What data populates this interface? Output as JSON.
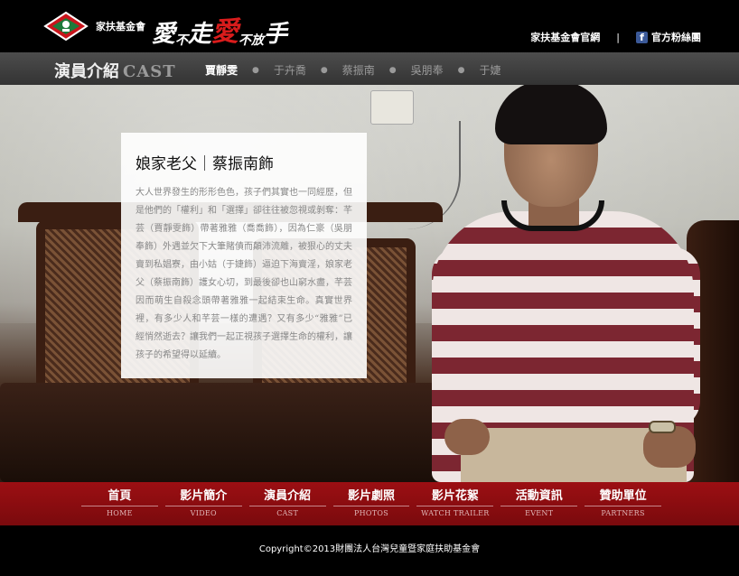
{
  "header": {
    "org_name": "家扶基金會",
    "slogan": {
      "part1": "愛",
      "part2": "不",
      "part3": "走",
      "part4": "愛",
      "part5": "不",
      "part6": "放",
      "part7": "手"
    },
    "links": {
      "official_site": "家扶基金會官網",
      "separator": "|",
      "fan_page": "官方粉絲團",
      "fb_glyph": "f"
    },
    "logo_icon": "fcf-logo-icon"
  },
  "cast_bar": {
    "title_cn": "演員介紹",
    "title_en": "CAST",
    "members": [
      "賈靜雯",
      "于卉喬",
      "蔡振南",
      "吳朋奉",
      "于婕"
    ],
    "active_index": 0
  },
  "profile": {
    "title": "娘家老父｜蔡振南飾",
    "body": "大人世界發生的形形色色，孩子們其實也一同經歷，但是他們的「權利」和「選擇」卻往往被忽視或剝奪：芊芸（賈靜雯飾）帶著雅雅（喬喬飾），因為仁豪（吳朋奉飾）外遇並欠下大筆賭債而顛沛流離，被狠心的丈夫賣到私娼寮，由小姑（于婕飾）逼迫下海賣淫，娘家老父（蔡振南飾）護女心切，到最後卻也山窮水盡，芊芸因而萌生自殺念頭帶著雅雅一起結束生命。真實世界裡，有多少人和芊芸一樣的遭遇？又有多少“雅雅”已經悄然逝去？讓我們一起正視孩子選擇生命的權利，讓孩子的希望得以延續。"
  },
  "main_nav": [
    {
      "cn": "首頁",
      "en": "HOME"
    },
    {
      "cn": "影片簡介",
      "en": "VIDEO"
    },
    {
      "cn": "演員介紹",
      "en": "CAST"
    },
    {
      "cn": "影片劇照",
      "en": "PHOTOS"
    },
    {
      "cn": "影片花絮",
      "en": "WATCH TRAILER"
    },
    {
      "cn": "活動資訊",
      "en": "EVENT"
    },
    {
      "cn": "贊助單位",
      "en": "PARTNERS"
    }
  ],
  "footer": {
    "copyright": "Copyright©2013財團法人台灣兒童暨家庭扶助基金會"
  },
  "colors": {
    "brand_red": "#9c0f13",
    "slogan_red": "#d91c1c",
    "facebook_blue": "#3b5998"
  }
}
